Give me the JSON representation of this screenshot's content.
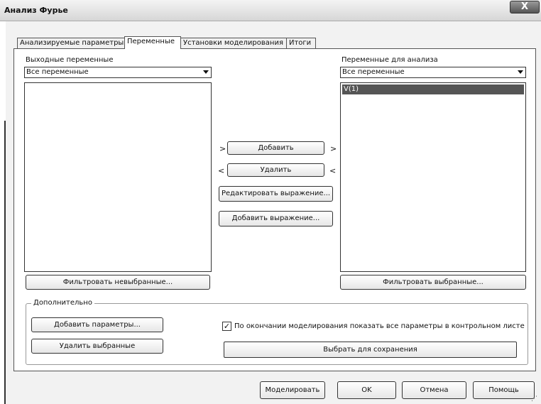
{
  "window": {
    "title": "Анализ Фурье",
    "close_label": "X"
  },
  "tabs": [
    {
      "label": "Анализируемые параметры"
    },
    {
      "label": "Переменные"
    },
    {
      "label": "Установки моделирования"
    },
    {
      "label": "Итоги"
    }
  ],
  "active_tab": "Переменные",
  "output_vars": {
    "label": "Выходные переменные",
    "filter_value": "Все переменные",
    "items": [],
    "filter_button": "Фильтровать невыбранные..."
  },
  "analysis_vars": {
    "label": "Переменные для анализа",
    "filter_value": "Все переменные",
    "items": [
      "V(1)"
    ],
    "filter_button": "Фильтровать выбранные..."
  },
  "middle": {
    "add_label": "Добавить",
    "remove_label": "Удалить",
    "edit_expr_label": "Редактировать выражение...",
    "add_expr_label": "Добавить выражение...",
    "arrow_right": ">",
    "arrow_left": "<"
  },
  "more": {
    "title": "Дополнительно",
    "add_params_label": "Добавить параметры...",
    "remove_selected_label": "Удалить выбранные",
    "show_all_params": {
      "label": "По окончании моделирования показать все параметры в контрольном листе",
      "checked": true,
      "mark": "✓"
    },
    "select_to_save_label": "Выбрать для сохранения"
  },
  "footer": {
    "simulate_label": "Моделировать",
    "ok_label": "OK",
    "cancel_label": "Отмена",
    "help_label": "Помощь"
  }
}
